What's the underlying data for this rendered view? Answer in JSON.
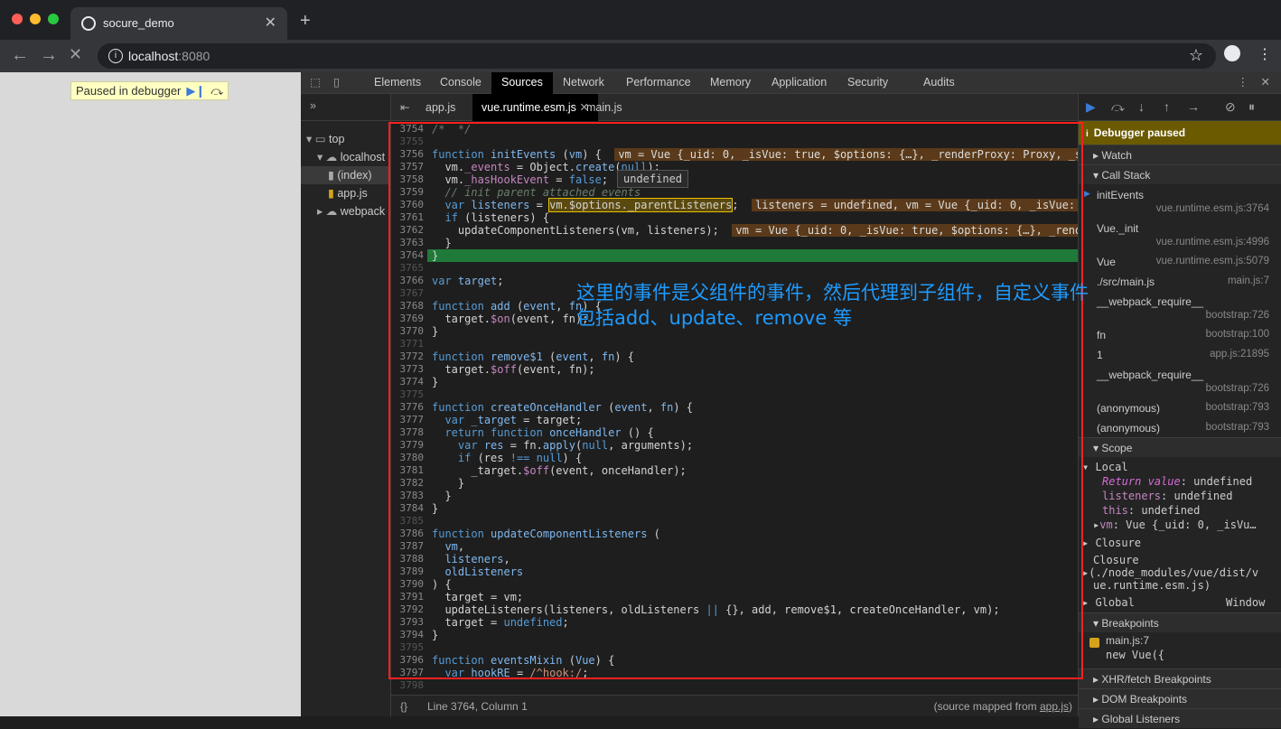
{
  "browser": {
    "tab_title": "socure_demo",
    "url_host": "localhost",
    "url_port": ":8080",
    "new_tab": "+",
    "close": "✕"
  },
  "page": {
    "paused_label": "Paused in debugger"
  },
  "devtools": {
    "tabs": [
      "Elements",
      "Console",
      "Sources",
      "Network",
      "Performance",
      "Memory",
      "Application",
      "Security",
      "Audits"
    ],
    "active_tab": "Sources",
    "navigator": [
      {
        "label": "top",
        "indent": 0
      },
      {
        "label": "localhost",
        "indent": 1
      },
      {
        "label": "(index)",
        "indent": 2
      },
      {
        "label": "app.js",
        "indent": 2
      },
      {
        "label": "webpack",
        "indent": 1
      }
    ],
    "file_tabs": [
      "app.js",
      "vue.runtime.esm.js",
      "main.js"
    ],
    "active_file": "vue.runtime.esm.js",
    "tooltip": "undefined",
    "status_position": "Line 3764, Column 1",
    "status_source": "(source mapped from ",
    "status_source_link": "app.js",
    "status_source_end": ")",
    "braces": "{}"
  },
  "code_lines": [
    {
      "n": "3754",
      "html": "<span class='cm'>/*  */</span>"
    },
    {
      "n": "3755",
      "html": ""
    },
    {
      "n": "3756",
      "html": "<span class='k'>function</span> <span class='fn'>initEvents</span> (<span class='fn'>vm</span>) {  <span class='inl'>vm = Vue {_uid: 0, _isVue: true, $options: {…}, _renderProxy: Proxy, _s</span>"
    },
    {
      "n": "3757",
      "html": "  vm.<span class='p'>_events</span> = Object.<span class='fn'>create</span>(<span class='k'>null</span>);"
    },
    {
      "n": "3758",
      "html": "  vm.<span class='p'>_hasHookEvent</span> = <span class='k'>false</span>;"
    },
    {
      "n": "3759",
      "html": "  <span class='cm'>// init parent attached events</span>"
    },
    {
      "n": "3760",
      "html": "  <span class='k'>var</span> <span class='fn'>listeners</span> = <span style='background:#5b4a10;outline:1px solid #e8c000'>vm.$options._parentListeners</span>;  <span class='inl'>listeners = undefined, vm = Vue {_uid: 0, _isVue:</span>"
    },
    {
      "n": "3761",
      "html": "  <span class='k'>if</span> (listeners) {"
    },
    {
      "n": "3762",
      "html": "    updateComponentListeners(vm, listeners);  <span class='inl'>vm = Vue {_uid: 0, _isVue: true, $options: {…}, _rend</span>"
    },
    {
      "n": "3763",
      "html": "  }"
    },
    {
      "n": "3764",
      "html": "}",
      "hl": true
    },
    {
      "n": "3765",
      "html": ""
    },
    {
      "n": "3766",
      "html": "<span class='k'>var</span> <span class='fn'>target</span>;"
    },
    {
      "n": "3767",
      "html": ""
    },
    {
      "n": "3768",
      "html": "<span class='k'>function</span> <span class='fn'>add</span> (<span class='fn'>event</span>, <span class='fn'>fn</span>) {"
    },
    {
      "n": "3769",
      "html": "  target.<span class='p'>$on</span>(event, fn);"
    },
    {
      "n": "3770",
      "html": "}"
    },
    {
      "n": "3771",
      "html": ""
    },
    {
      "n": "3772",
      "html": "<span class='k'>function</span> <span class='fn'>remove$1</span> (<span class='fn'>event</span>, <span class='fn'>fn</span>) {"
    },
    {
      "n": "3773",
      "html": "  target.<span class='p'>$off</span>(event, fn);"
    },
    {
      "n": "3774",
      "html": "}"
    },
    {
      "n": "3775",
      "html": ""
    },
    {
      "n": "3776",
      "html": "<span class='k'>function</span> <span class='fn'>createOnceHandler</span> (<span class='fn'>event</span>, <span class='fn'>fn</span>) {"
    },
    {
      "n": "3777",
      "html": "  <span class='k'>var</span> <span class='fn'>_target</span> = target;"
    },
    {
      "n": "3778",
      "html": "  <span class='k'>return</span> <span class='k'>function</span> <span class='fn'>onceHandler</span> () {"
    },
    {
      "n": "3779",
      "html": "    <span class='k'>var</span> <span class='fn'>res</span> = fn.<span class='fn'>apply</span>(<span class='k'>null</span>, arguments);"
    },
    {
      "n": "3780",
      "html": "    <span class='k'>if</span> (res <span class='k'>!==</span> <span class='k'>null</span>) {"
    },
    {
      "n": "3781",
      "html": "      _target.<span class='p'>$off</span>(event, onceHandler);"
    },
    {
      "n": "3782",
      "html": "    }"
    },
    {
      "n": "3783",
      "html": "  }"
    },
    {
      "n": "3784",
      "html": "}"
    },
    {
      "n": "3785",
      "html": ""
    },
    {
      "n": "3786",
      "html": "<span class='k'>function</span> <span class='fn'>updateComponentListeners</span> ("
    },
    {
      "n": "3787",
      "html": "  <span class='fn'>vm</span>,"
    },
    {
      "n": "3788",
      "html": "  <span class='fn'>listeners</span>,"
    },
    {
      "n": "3789",
      "html": "  <span class='fn'>oldListeners</span>"
    },
    {
      "n": "3790",
      "html": ") {"
    },
    {
      "n": "3791",
      "html": "  target = vm;"
    },
    {
      "n": "3792",
      "html": "  updateListeners(listeners, oldListeners <span class='k'>||</span> {}, add, remove$1, createOnceHandler, vm);"
    },
    {
      "n": "3793",
      "html": "  target = <span class='k'>undefined</span>;"
    },
    {
      "n": "3794",
      "html": "}"
    },
    {
      "n": "3795",
      "html": ""
    },
    {
      "n": "3796",
      "html": "<span class='k'>function</span> <span class='fn'>eventsMixin</span> (<span class='fn'>Vue</span>) {"
    },
    {
      "n": "3797",
      "html": "  <span class='k'>var</span> <span class='fn'>hookRE</span> = <span class='s'>/^hook:/</span>;"
    },
    {
      "n": "3798",
      "html": ""
    }
  ],
  "right": {
    "paused_title": "Debugger paused",
    "watch": "Watch",
    "call_stack": "Call Stack",
    "frames": [
      {
        "name": "initEvents",
        "loc": "vue.runtime.esm.js:3764",
        "two": true,
        "active": true
      },
      {
        "name": "Vue._init",
        "loc": "vue.runtime.esm.js:4996",
        "two": true
      },
      {
        "name": "Vue",
        "loc": "vue.runtime.esm.js:5079"
      },
      {
        "name": "./src/main.js",
        "loc": "main.js:7"
      },
      {
        "name": "__webpack_require__",
        "loc": "bootstrap:726",
        "two": true
      },
      {
        "name": "fn",
        "loc": "bootstrap:100"
      },
      {
        "name": "1",
        "loc": "app.js:21895"
      },
      {
        "name": "__webpack_require__",
        "loc": "bootstrap:726",
        "two": true
      },
      {
        "name": "(anonymous)",
        "loc": "bootstrap:793"
      },
      {
        "name": "(anonymous)",
        "loc": "bootstrap:793"
      }
    ],
    "scope": "Scope",
    "local": "Local",
    "return_value_key": "Return value",
    "return_value_val": "undefined",
    "listeners_key": "listeners",
    "listeners_val": "undefined",
    "this_key": "this",
    "this_val": "undefined",
    "vm_key": "vm",
    "vm_val": "Vue {_uid: 0, _isVu…",
    "closure": "Closure",
    "closure2": "Closure",
    "closure_path_1": "(./node_modules/vue/dist/v",
    "closure_path_2": "ue.runtime.esm.js)",
    "global": "Global",
    "global_val": "Window",
    "breakpoints": "Breakpoints",
    "bp_file": "main.js:7",
    "bp_code": "new Vue({",
    "xhr": "XHR/fetch Breakpoints",
    "dom": "DOM Breakpoints",
    "global_listeners": "Global Listeners"
  },
  "annotation": {
    "line1": "这里的事件是父组件的事件，然后代理到子组件，自定义事件",
    "line2": "包括add、update、remove 等"
  },
  "colors": {
    "annotation": "#1e9bff",
    "box": "#ff2020",
    "current_line": "#1f7a3a",
    "paused_banner": "#6b5a00"
  }
}
